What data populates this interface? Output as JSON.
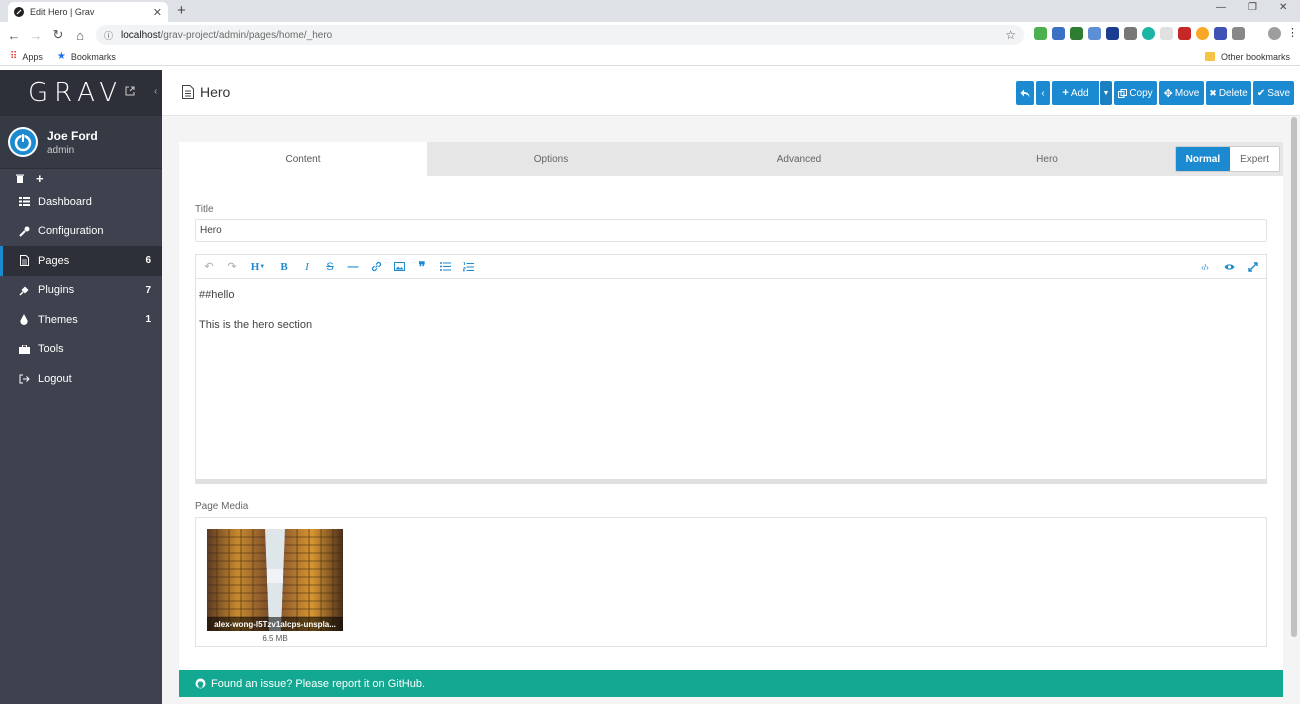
{
  "browser": {
    "tab_title": "Edit Hero | Grav",
    "url_host": "localhost",
    "url_path": "/grav-project/admin/pages/home/_hero",
    "bookmarks": {
      "apps": "Apps",
      "bookmarks": "Bookmarks",
      "other": "Other bookmarks"
    }
  },
  "sidebar": {
    "logo": "GRAV",
    "user": {
      "name": "Joe Ford",
      "role": "admin"
    },
    "items": [
      {
        "label": "Dashboard",
        "icon": "dashboard-icon"
      },
      {
        "label": "Configuration",
        "icon": "wrench-icon"
      },
      {
        "label": "Pages",
        "icon": "file-icon",
        "count": "6",
        "active": true
      },
      {
        "label": "Plugins",
        "icon": "plug-icon",
        "count": "7"
      },
      {
        "label": "Themes",
        "icon": "tint-icon",
        "count": "1"
      },
      {
        "label": "Tools",
        "icon": "briefcase-icon"
      },
      {
        "label": "Logout",
        "icon": "sign-out-icon"
      }
    ]
  },
  "header": {
    "title": "Hero",
    "actions": {
      "add": "Add",
      "copy": "Copy",
      "move": "Move",
      "delete": "Delete",
      "save": "Save"
    }
  },
  "tabs": [
    "Content",
    "Options",
    "Advanced",
    "Hero"
  ],
  "mode": {
    "normal": "Normal",
    "expert": "Expert"
  },
  "form": {
    "title_label": "Title",
    "title_value": "Hero",
    "editor_line1": "##hello",
    "editor_line2": "This is the hero section",
    "media_label": "Page Media",
    "media_file": "alex-wong-l5Tzv1alcps-unspla...",
    "media_size": "6.5 MB"
  },
  "footer": {
    "text": "Found an issue? Please report it on GitHub."
  },
  "colors": {
    "accent": "#1c8ad0",
    "sidebar": "#3d424e",
    "footer": "#13a892"
  }
}
